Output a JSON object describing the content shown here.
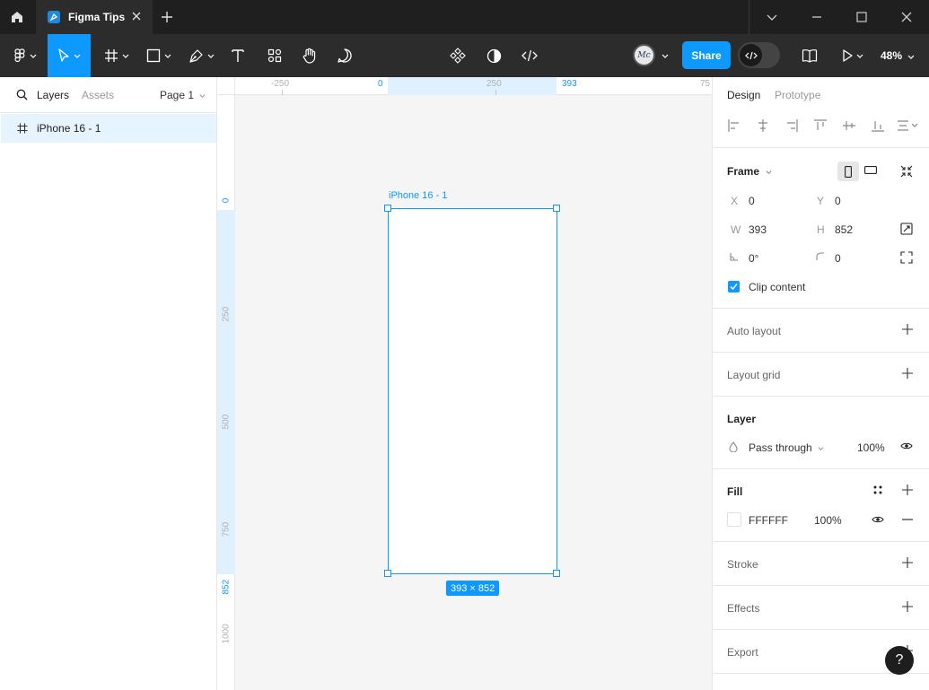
{
  "tab": {
    "title": "Figma Tips"
  },
  "toolbar": {
    "share_label": "Share",
    "zoom": "48%",
    "avatar_initials": "Mc"
  },
  "left_panel": {
    "tabs": [
      "Layers",
      "Assets"
    ],
    "page": "Page 1",
    "layers": [
      {
        "name": "iPhone 16 - 1",
        "type": "frame"
      }
    ]
  },
  "canvas": {
    "frame_name": "iPhone 16 - 1",
    "size_badge": "393 × 852",
    "ruler_x": [
      "-250",
      "0",
      "250",
      "393",
      "75"
    ],
    "ruler_y": [
      "0",
      "250",
      "500",
      "750",
      "852",
      "1000"
    ]
  },
  "right_panel": {
    "tabs": [
      "Design",
      "Prototype"
    ],
    "frame": {
      "title": "Frame",
      "x_label": "X",
      "x": "0",
      "y_label": "Y",
      "y": "0",
      "w_label": "W",
      "w": "393",
      "h_label": "H",
      "h": "852",
      "rotation": "0°",
      "radius": "0",
      "clip_content": "Clip content"
    },
    "auto_layout": "Auto layout",
    "layout_grid": "Layout grid",
    "layer": {
      "title": "Layer",
      "blend": "Pass through",
      "opacity": "100%"
    },
    "fill": {
      "title": "Fill",
      "hex": "FFFFFF",
      "opacity": "100%"
    },
    "stroke": "Stroke",
    "effects": "Effects",
    "export": "Export",
    "help": "?"
  },
  "colors": {
    "accent": "#0d99ff",
    "titlebar": "#1f1f1f",
    "toolbar": "#2c2c2c",
    "canvas": "#f5f5f5"
  }
}
